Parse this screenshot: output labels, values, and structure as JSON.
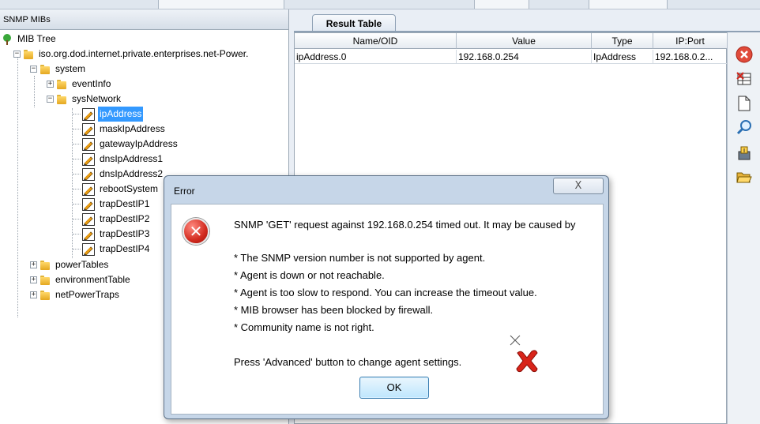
{
  "left_panel": {
    "header": "SNMP MIBs",
    "tree": {
      "root": "MIB Tree",
      "enterprise": "iso.org.dod.internet.private.enterprises.net-Power.",
      "system": "system",
      "eventInfo": "eventInfo",
      "sysNetwork": "sysNetwork",
      "leaves": [
        "ipAddress",
        "maskIpAddress",
        "gatewayIpAddress",
        "dnsIpAddress1",
        "dnsIpAddress2",
        "rebootSystem",
        "trapDestIP1",
        "trapDestIP2",
        "trapDestIP3",
        "trapDestIP4"
      ],
      "selected": "ipAddress",
      "powerTables": "powerTables",
      "environmentTable": "environmentTable",
      "netPowerTraps": "netPowerTraps"
    }
  },
  "result": {
    "tab_label": "Result Table",
    "columns": [
      "Name/OID",
      "Value",
      "Type",
      "IP:Port"
    ],
    "rows": [
      [
        "ipAddress.0",
        "192.168.0.254",
        "IpAddress",
        "192.168.0.2..."
      ]
    ]
  },
  "toolbar": {
    "icons": [
      "stop-icon",
      "clear-table-icon",
      "new-document-icon",
      "search-icon",
      "export-icon",
      "open-folder-icon"
    ]
  },
  "dialog": {
    "title": "Error",
    "close_glyph": "X",
    "message": "SNMP 'GET' request against 192.168.0.254 timed out. It may be caused by",
    "reasons": [
      "* The SNMP version number is not supported by agent.",
      "* Agent is down or not reachable.",
      "* Agent is too slow to respond. You can increase the timeout value.",
      "* MIB browser has been blocked by firewall.",
      "* Community name is not right."
    ],
    "advice": "Press 'Advanced' button to change agent settings.",
    "ok_label": "OK"
  }
}
